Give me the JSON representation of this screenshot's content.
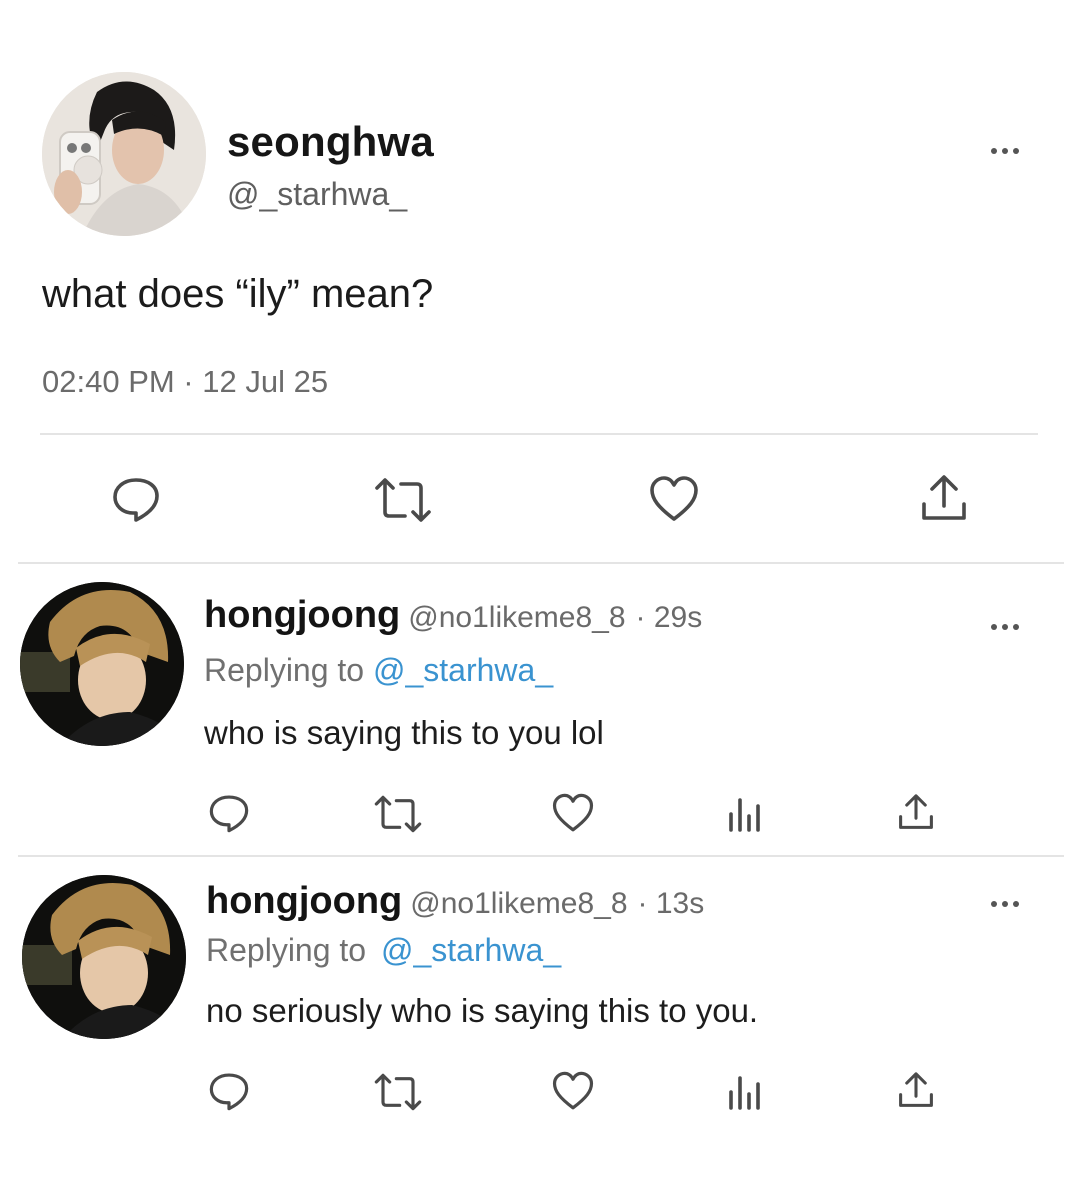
{
  "main_tweet": {
    "display_name": "seonghwa",
    "handle": "@_starhwa_",
    "text": "what does “ily” mean?",
    "timestamp": "02:40 PM · 12 Jul 25",
    "avatar": "avatar-photo",
    "more_icon": "more-dots-icon",
    "actions": [
      "reply-icon",
      "retweet-icon",
      "like-icon",
      "share-icon"
    ]
  },
  "replies": [
    {
      "display_name": "hongjoong",
      "handle": "@no1likeme8_8",
      "time": "· 29s",
      "replying_prefix": "Replying to",
      "replying_to": "@_starhwa_",
      "text": "who is saying this to you lol",
      "actions": [
        "reply-icon",
        "retweet-icon",
        "like-icon",
        "analytics-icon",
        "share-icon"
      ]
    },
    {
      "display_name": "hongjoong",
      "handle": "@no1likeme8_8",
      "time": "· 13s",
      "replying_prefix": "Replying to",
      "replying_to": "@_starhwa_",
      "text": "no seriously who is saying this to you.",
      "actions": [
        "reply-icon",
        "retweet-icon",
        "like-icon",
        "analytics-icon",
        "share-icon"
      ]
    }
  ],
  "colors": {
    "mention": "#3a93d0",
    "text": "#1b1b1b",
    "secondary": "#6b6b6b",
    "icon": "#4a4a4a"
  }
}
